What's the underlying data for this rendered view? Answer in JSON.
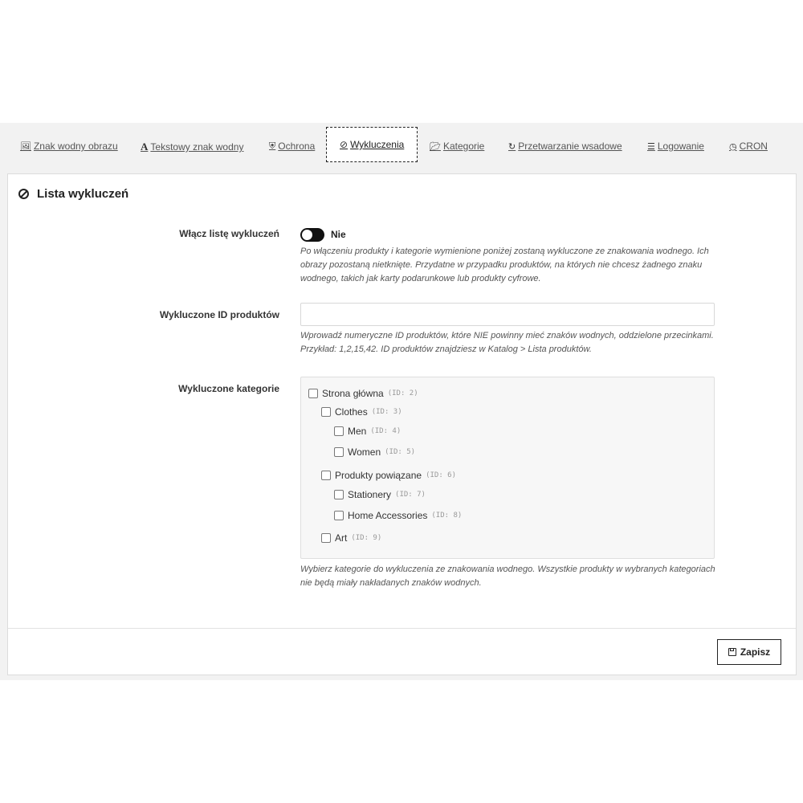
{
  "tabs": [
    {
      "label": "Znak wodny obrazu",
      "icon": "image-icon"
    },
    {
      "label": "Tekstowy znak wodny",
      "icon": "text-icon"
    },
    {
      "label": "Ochrona",
      "icon": "shield-icon"
    },
    {
      "label": "Wykluczenia",
      "icon": "ban-icon"
    },
    {
      "label": "Kategorie",
      "icon": "folder-icon"
    },
    {
      "label": "Przetwarzanie wsadowe",
      "icon": "refresh-icon"
    },
    {
      "label": "Logowanie",
      "icon": "list-icon"
    },
    {
      "label": "CRON",
      "icon": "clock-icon"
    }
  ],
  "active_tab": "Wykluczenia",
  "panel": {
    "title": "Lista wykluczeń",
    "enable": {
      "label": "Włącz listę wykluczeń",
      "state": "Nie",
      "help": "Po włączeniu produkty i kategorie wymienione poniżej zostaną wykluczone ze znakowania wodnego. Ich obrazy pozostaną nietknięte. Przydatne w przypadku produktów, na których nie chcesz żadnego znaku wodnego, takich jak karty podarunkowe lub produkty cyfrowe."
    },
    "products": {
      "label": "Wykluczone ID produktów",
      "value": "",
      "placeholder": "",
      "help": "Wprowadź numeryczne ID produktów, które NIE powinny mieć znaków wodnych, oddzielone przecinkami. Przykład: 1,2,15,42. ID produktów znajdziesz w Katalog > Lista produktów."
    },
    "categories": {
      "label": "Wykluczone kategorie",
      "items": [
        {
          "name": "Strona główna",
          "id": "(ID: 2)"
        },
        {
          "name": "Clothes",
          "id": "(ID: 3)"
        },
        {
          "name": "Men",
          "id": "(ID: 4)"
        },
        {
          "name": "Women",
          "id": "(ID: 5)"
        },
        {
          "name": "Produkty powiązane",
          "id": "(ID: 6)"
        },
        {
          "name": "Stationery",
          "id": "(ID: 7)"
        },
        {
          "name": "Home Accessories",
          "id": "(ID: 8)"
        },
        {
          "name": "Art",
          "id": "(ID: 9)"
        }
      ],
      "help": "Wybierz kategorie do wykluczenia ze znakowania wodnego. Wszystkie produkty w wybranych kategoriach nie będą miały nakładanych znaków wodnych."
    }
  },
  "save_label": "Zapisz"
}
